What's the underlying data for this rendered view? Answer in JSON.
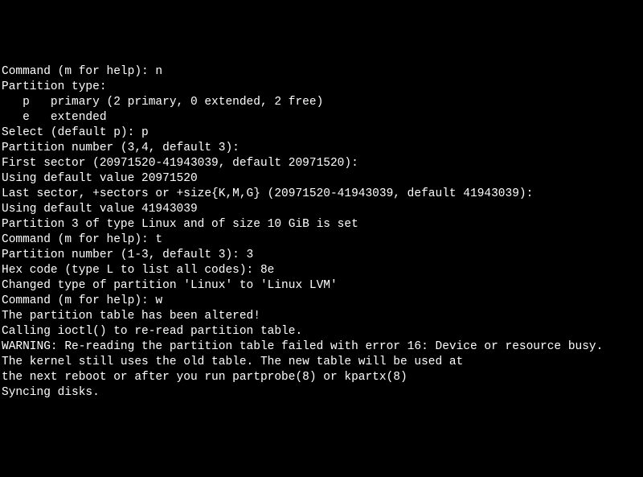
{
  "lines": {
    "l1": "Command (m for help): n",
    "l2": "Partition type:",
    "l3": "   p   primary (2 primary, 0 extended, 2 free)",
    "l4": "   e   extended",
    "l5": "Select (default p): p",
    "l6": "Partition number (3,4, default 3):",
    "l7": "First sector (20971520-41943039, default 20971520):",
    "l8": "Using default value 20971520",
    "l9": "Last sector, +sectors or +size{K,M,G} (20971520-41943039, default 41943039):",
    "l10": "Using default value 41943039",
    "l11": "Partition 3 of type Linux and of size 10 GiB is set",
    "l12": "",
    "l13": "Command (m for help): t",
    "l14": "Partition number (1-3, default 3): 3",
    "l15": "Hex code (type L to list all codes): 8e",
    "l16": "Changed type of partition 'Linux' to 'Linux LVM'",
    "l17": "",
    "l18": "Command (m for help): w",
    "l19": "The partition table has been altered!",
    "l20": "",
    "l21": "Calling ioctl() to re-read partition table.",
    "l22": "",
    "l23": "WARNING: Re-reading the partition table failed with error 16: Device or resource busy.",
    "l24": "The kernel still uses the old table. The new table will be used at",
    "l25": "the next reboot or after you run partprobe(8) or kpartx(8)",
    "l26": "Syncing disks."
  }
}
